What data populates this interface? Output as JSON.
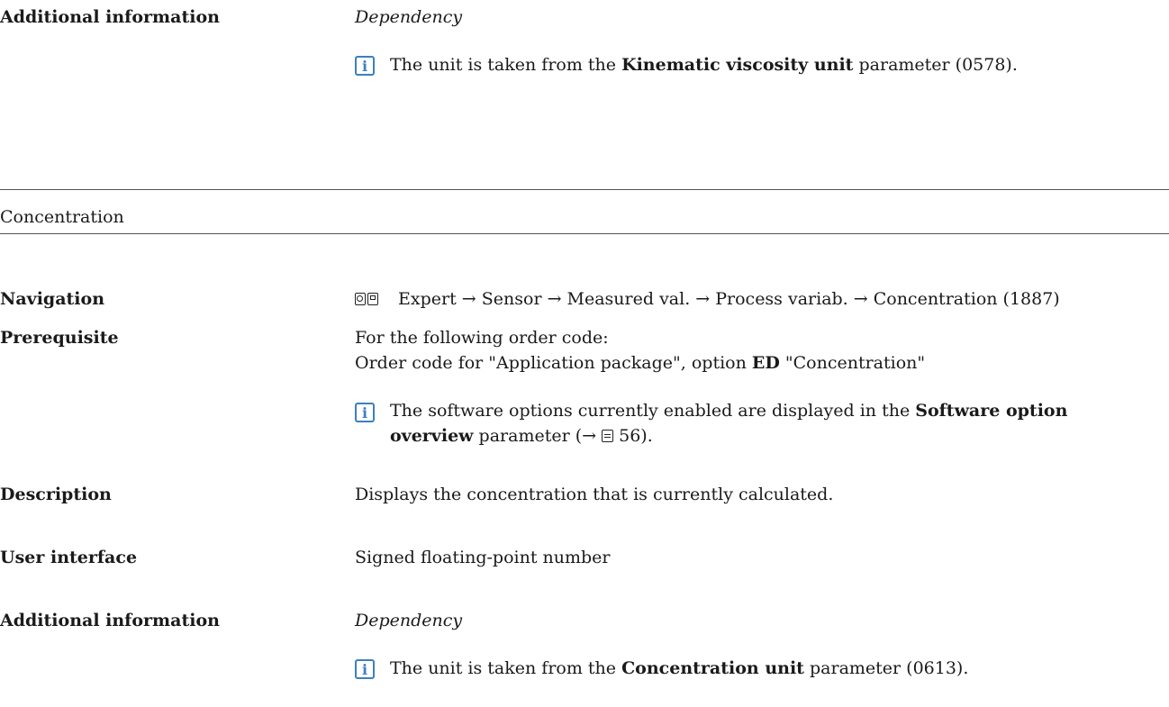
{
  "top": {
    "label": "Additional information",
    "dependency": "Dependency",
    "note_pre": "The unit is taken from the ",
    "note_bold": "Kinematic viscosity unit",
    "note_post": " parameter (0578)."
  },
  "section": {
    "title": "Concentration"
  },
  "navigation": {
    "label": "Navigation",
    "path": "Expert → Sensor → Measured val. → Process variab. → Concentration (1887)"
  },
  "prerequisite": {
    "label": "Prerequisite",
    "line1": "For the following order code:",
    "line2_pre": "Order code for \"Application package\", option ",
    "line2_bold": "ED",
    "line2_post": " \"Concentration\"",
    "note_pre": "The software options currently enabled are displayed in the ",
    "note_bold1": "Software option",
    "note_bold2": "overview",
    "note_mid": " parameter (→ ",
    "note_page": " 56)."
  },
  "description": {
    "label": "Description",
    "value": "Displays the concentration that is currently calculated."
  },
  "user_interface": {
    "label": "User interface",
    "value": "Signed floating-point number"
  },
  "additional": {
    "label": "Additional information",
    "dependency": "Dependency",
    "note_pre": "The unit is taken from the ",
    "note_bold": "Concentration unit",
    "note_post": " parameter (0613)."
  },
  "icons": [
    "info-icon",
    "display-operation-icon",
    "operating-tool-icon",
    "page-reference-icon"
  ],
  "colors": {
    "info_accent": "#3d7fc0",
    "rule": "#555555",
    "text": "#1a1a1a"
  }
}
